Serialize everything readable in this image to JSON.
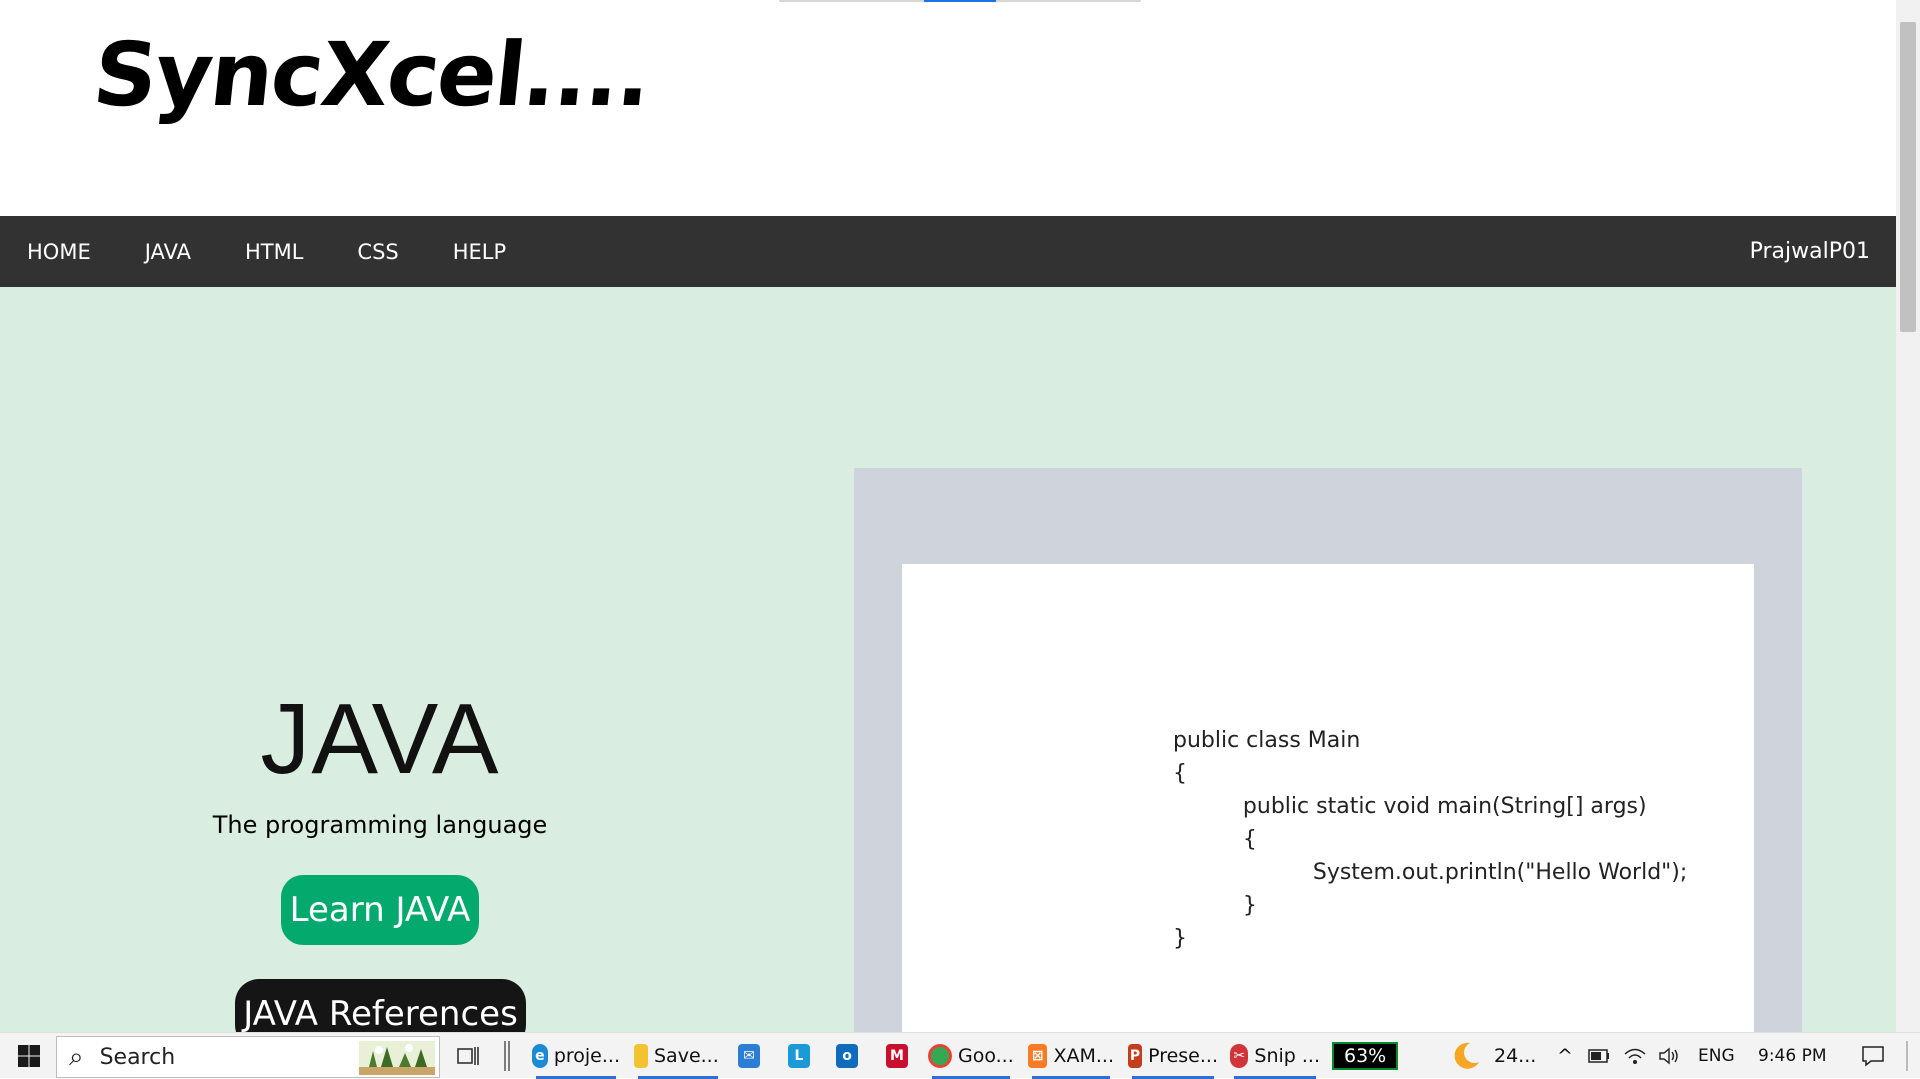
{
  "site": {
    "logo": "SyncXcel....",
    "nav": {
      "links": [
        "HOME",
        "JAVA",
        "HTML",
        "CSS",
        "HELP"
      ],
      "user": "PrajwalP01"
    },
    "hero": {
      "title": "JAVA",
      "subtitle": "The programming language",
      "learn_button": "Learn JAVA",
      "reference_button": "JAVA References"
    },
    "code_example": {
      "lines": [
        "public class Main",
        "{",
        "          public static void main(String[] args)",
        "          {",
        "                    System.out.println(\"Hello World\");",
        "          }",
        "}"
      ]
    }
  },
  "taskbar": {
    "search_placeholder": "Search",
    "apps": [
      {
        "label": "proje...",
        "icon": "edge-icon",
        "color": "#1a8ad4"
      },
      {
        "label": "Save...",
        "icon": "file-explorer-icon",
        "color": "#f2c230"
      },
      {
        "label": "",
        "icon": "mail-icon",
        "color": "#2a7fd4"
      },
      {
        "label": "",
        "icon": "l-app-icon",
        "color": "#1a9ad8"
      },
      {
        "label": "",
        "icon": "outlook-icon",
        "color": "#0f6cbd"
      },
      {
        "label": "",
        "icon": "mcafee-icon",
        "color": "#c8102e"
      },
      {
        "label": "Goo...",
        "icon": "chrome-icon",
        "color": "#34a853"
      },
      {
        "label": "XAM...",
        "icon": "xampp-icon",
        "color": "#fb7a24"
      },
      {
        "label": "Prese...",
        "icon": "powerpoint-icon",
        "color": "#c43e1c"
      },
      {
        "label": "Snip ...",
        "icon": "snipping-tool-icon",
        "color": "#d13438"
      }
    ],
    "battery_percent": "63%",
    "weather": "24...",
    "language": "ENG",
    "time": "9:46 PM"
  }
}
